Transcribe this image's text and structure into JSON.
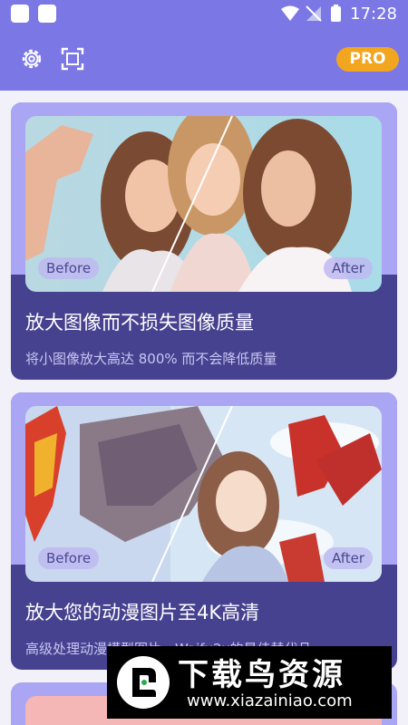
{
  "status_bar": {
    "time": "17:28"
  },
  "app_bar": {
    "settings_icon": "gear-icon",
    "crop_icon": "scan-frame-icon",
    "pro_label": "PRO"
  },
  "cards": [
    {
      "before": "Before",
      "after": "After",
      "title": "放大图像而不损失图像质量",
      "subtitle": "将小图像放大高达 800% 而不会降低质量"
    },
    {
      "before": "Before",
      "after": "After",
      "title": "放大您的动漫图片至4K高清",
      "subtitle": "高级处理动漫模型图片，Waifu2x的最佳替代品"
    }
  ],
  "watermark": {
    "title": "下载鸟资源",
    "url": "www.xiazainiao.com"
  },
  "colors": {
    "primary": "#7b78e6",
    "card": "#47428f",
    "card_top": "#aaa6f4",
    "pro": "#f2a51f"
  }
}
